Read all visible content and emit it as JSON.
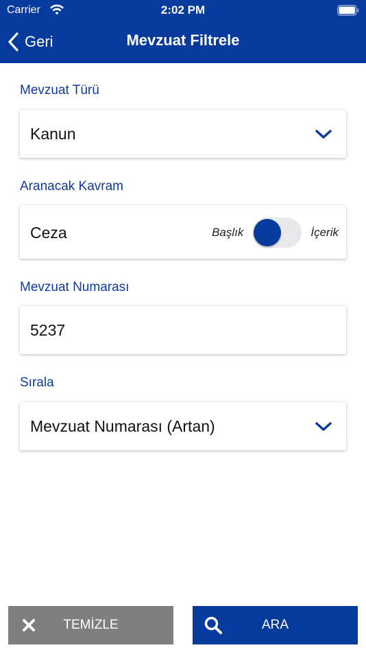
{
  "status_bar": {
    "carrier": "Carrier",
    "time": "2:02 PM"
  },
  "nav": {
    "back_label": "Geri",
    "title": "Mevzuat Filtrele"
  },
  "form": {
    "type": {
      "label": "Mevzuat Türü",
      "value": "Kanun"
    },
    "term": {
      "label": "Aranacak Kavram",
      "value": "Ceza",
      "toggle_left": "Başlık",
      "toggle_right": "İçerik",
      "toggle_on": false
    },
    "number": {
      "label": "Mevzuat Numarası",
      "value": "5237"
    },
    "sort": {
      "label": "Sırala",
      "value": "Mevzuat Numarası (Artan)"
    }
  },
  "buttons": {
    "clear_label": "TEMİZLE",
    "search_label": "ARA"
  },
  "colors": {
    "brand_blue": "#063a9c",
    "label_blue": "#0d3a9a",
    "clear_gray": "#7f7f7f"
  }
}
